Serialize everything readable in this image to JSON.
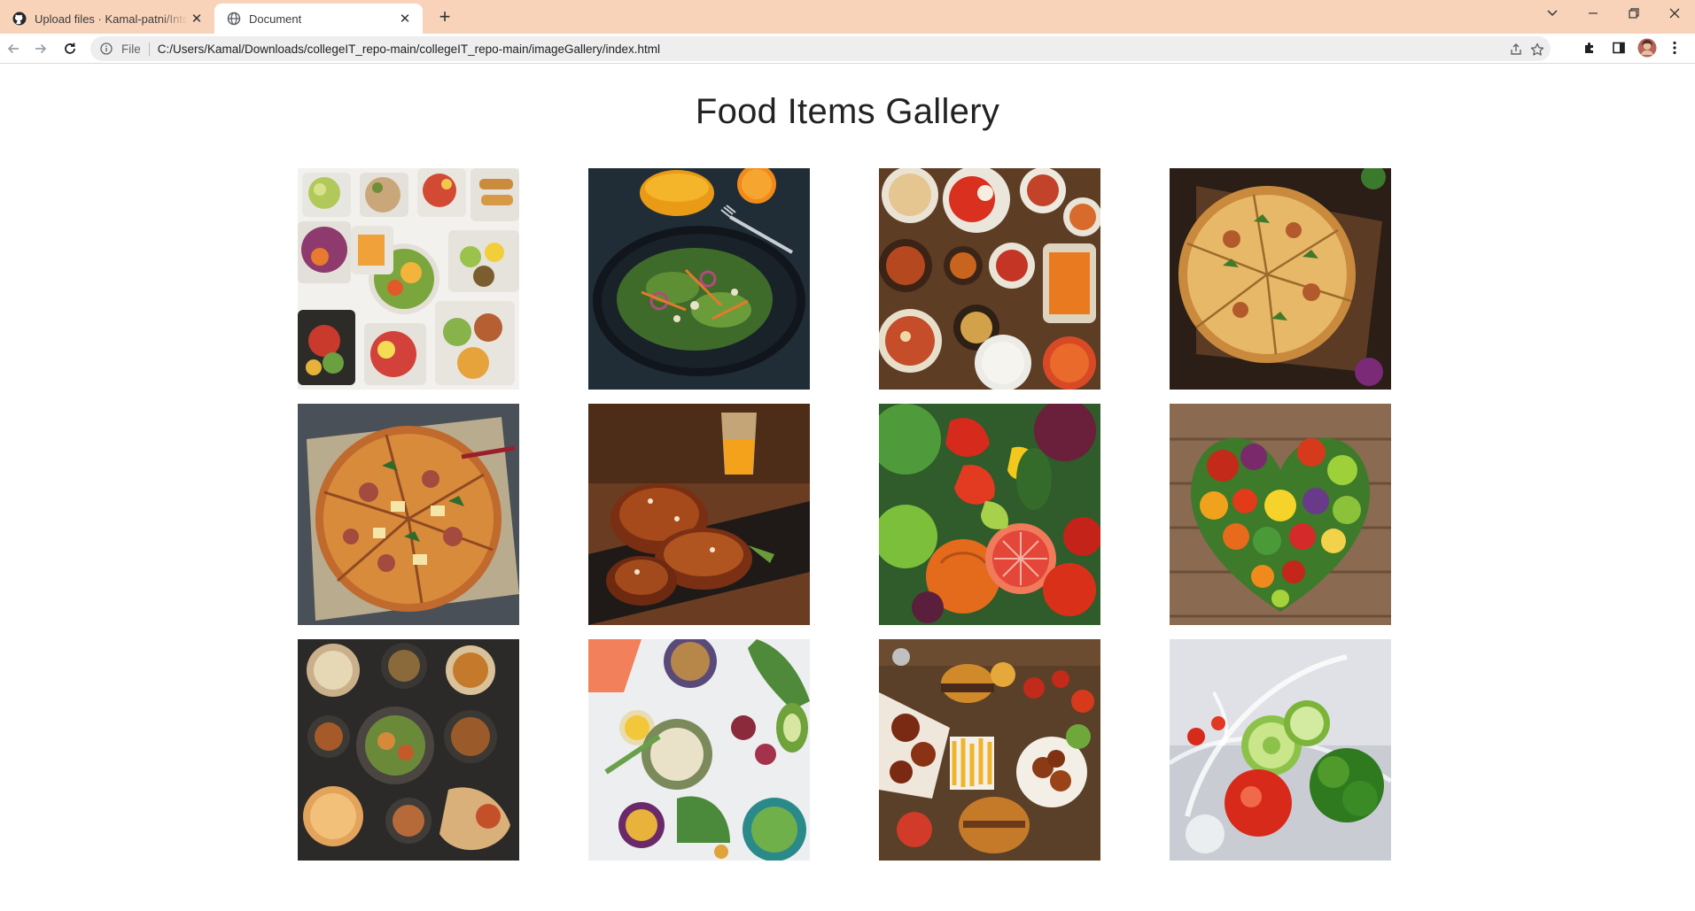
{
  "browser": {
    "tabs": [
      {
        "title": "Upload files · Kamal-patni/Intern",
        "favicon": "github-icon",
        "active": false
      },
      {
        "title": "Document",
        "favicon": "globe-icon",
        "active": true
      }
    ],
    "address_bar": {
      "scheme_label": "File",
      "url": "C:/Users/Kamal/Downloads/collegeIT_repo-main/collegeIT_repo-main/imageGallery/index.html"
    }
  },
  "page": {
    "title": "Food Items Gallery",
    "images": [
      {
        "subject": "salad-bowls",
        "icon": "food-photo"
      },
      {
        "subject": "dark-plate-salad-with-orange-juice",
        "icon": "food-photo"
      },
      {
        "subject": "indian-curry-spread",
        "icon": "food-photo"
      },
      {
        "subject": "pizza-on-wooden-board",
        "icon": "food-photo"
      },
      {
        "subject": "sliced-pizza-on-parchment",
        "icon": "food-photo"
      },
      {
        "subject": "glazed-chicken-wings",
        "icon": "food-photo"
      },
      {
        "subject": "fresh-vegetables-and-fruits",
        "icon": "food-photo"
      },
      {
        "subject": "heart-shaped-vegetables",
        "icon": "food-photo"
      },
      {
        "subject": "dinner-table-dishes",
        "icon": "food-photo"
      },
      {
        "subject": "healthy-ingredients",
        "icon": "food-photo"
      },
      {
        "subject": "fast-food-burgers-and-wings",
        "icon": "food-photo"
      },
      {
        "subject": "vegetables-water-splash",
        "icon": "food-photo"
      }
    ]
  },
  "colors": {
    "tabstrip": "#f9d3b9",
    "toolbar": "#ffffff",
    "omnibox": "#eeeeee",
    "title_text": "#222222"
  }
}
